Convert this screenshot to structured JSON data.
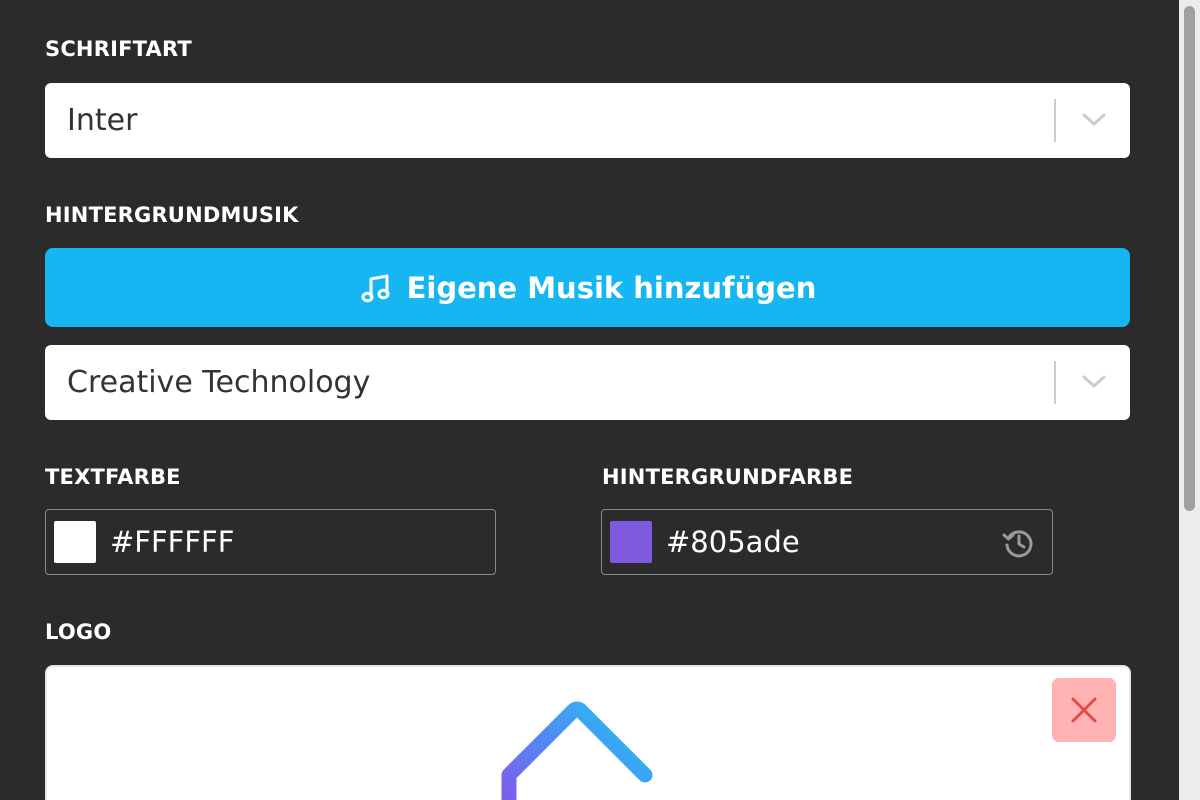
{
  "font_section": {
    "label": "SCHRIFTART",
    "selected": "Inter"
  },
  "music_section": {
    "label": "HINTERGRUNDMUSIK",
    "add_button_label": "Eigene Musik hinzufügen",
    "add_button_icon": "music-note-icon",
    "selected": "Creative Technology"
  },
  "text_color": {
    "label": "TEXTFARBE",
    "value": "#FFFFFF",
    "swatch": "#ffffff"
  },
  "background_color": {
    "label": "HINTERGRUNDFARBE",
    "value": "#805ade",
    "swatch": "#805ade",
    "reset_icon": "history-icon"
  },
  "logo_section": {
    "label": "LOGO",
    "remove_icon": "close-icon"
  },
  "colors": {
    "panel_bg": "#2b2b2b",
    "accent": "#15b6f2",
    "remove_bg": "#ffb3b3",
    "remove_fg": "#e84a4a"
  }
}
